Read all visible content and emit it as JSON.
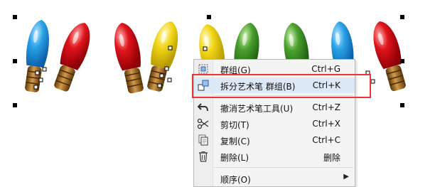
{
  "colors": {
    "blue": "#2aa3e6",
    "red": "#e0141b",
    "yellow": "#f2d619",
    "green": "#4aa02d",
    "brass": "#a0651e",
    "highlight_box": "#e53935"
  },
  "bulbs": [
    {
      "color": "blue",
      "icon": "blue-bulb"
    },
    {
      "color": "red",
      "icon": "red-bulb"
    },
    {
      "color": "red",
      "icon": "red-bulb"
    },
    {
      "color": "yellow",
      "icon": "yellow-bulb"
    },
    {
      "color": "yellow",
      "icon": "yellow-bulb"
    },
    {
      "color": "green",
      "icon": "green-bulb"
    },
    {
      "color": "green",
      "icon": "green-bulb"
    },
    {
      "color": "blue",
      "icon": "blue-bulb"
    },
    {
      "color": "red",
      "icon": "red-bulb"
    }
  ],
  "menu": {
    "items": [
      {
        "label": "群组(G)",
        "shortcut": "Ctrl+G",
        "icon": "group-icon"
      },
      {
        "label": "拆分艺术笔 群组(B)",
        "shortcut": "Ctrl+K",
        "icon": "break-apart-icon"
      },
      {
        "label": "撤消艺术笔工具(U)",
        "shortcut": "Ctrl+Z",
        "icon": "undo-icon"
      },
      {
        "label": "剪切(T)",
        "shortcut": "Ctrl+X",
        "icon": "scissors-icon"
      },
      {
        "label": "复制(C)",
        "shortcut": "Ctrl+C",
        "icon": "copy-icon"
      },
      {
        "label": "删除(L)",
        "shortcut": "删除",
        "icon": "trash-icon"
      },
      {
        "label": "顺序(O)",
        "shortcut": "",
        "icon": ""
      }
    ]
  }
}
